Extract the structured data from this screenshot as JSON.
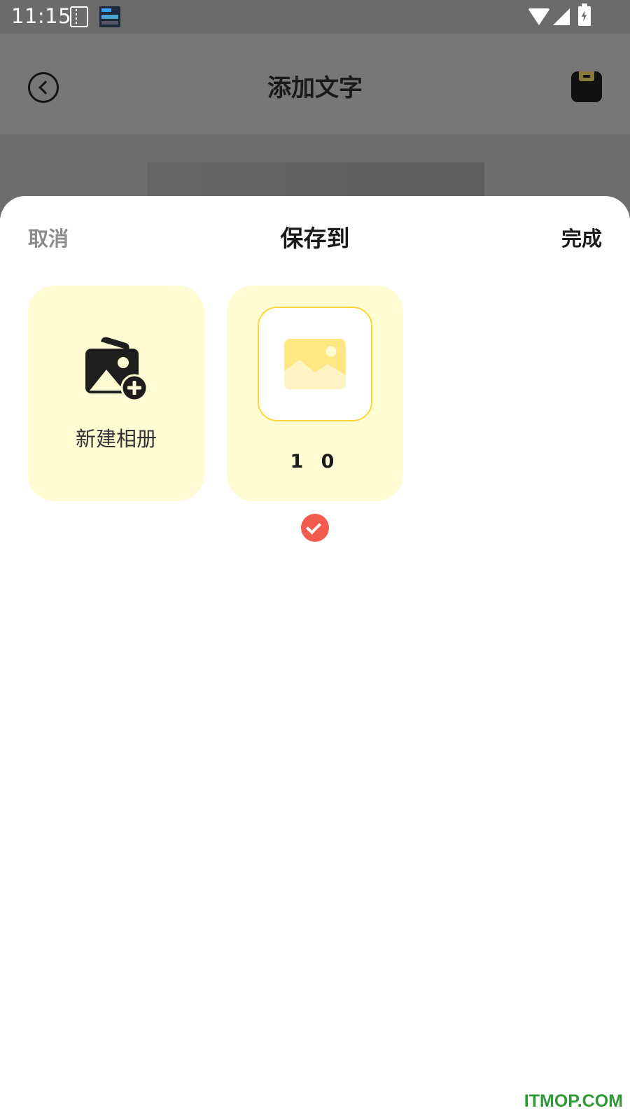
{
  "status_bar": {
    "time": "11:15"
  },
  "topbar": {
    "title": "添加文字",
    "back_icon": "back-arrow-circle",
    "save_icon": "save-icon"
  },
  "sheet": {
    "cancel_label": "取消",
    "title": "保存到",
    "done_label": "完成",
    "new_album": {
      "label": "新建相册",
      "icon": "add-album-icon"
    },
    "albums": [
      {
        "name": "1 0",
        "selected": true,
        "icon": "image-placeholder-icon"
      }
    ]
  },
  "watermark": "ITMOP.COM",
  "colors": {
    "card_bg": "#fffbd3",
    "thumb_border": "#ffd43b",
    "check": "#f45b4f",
    "watermark": "#2e9a35"
  }
}
